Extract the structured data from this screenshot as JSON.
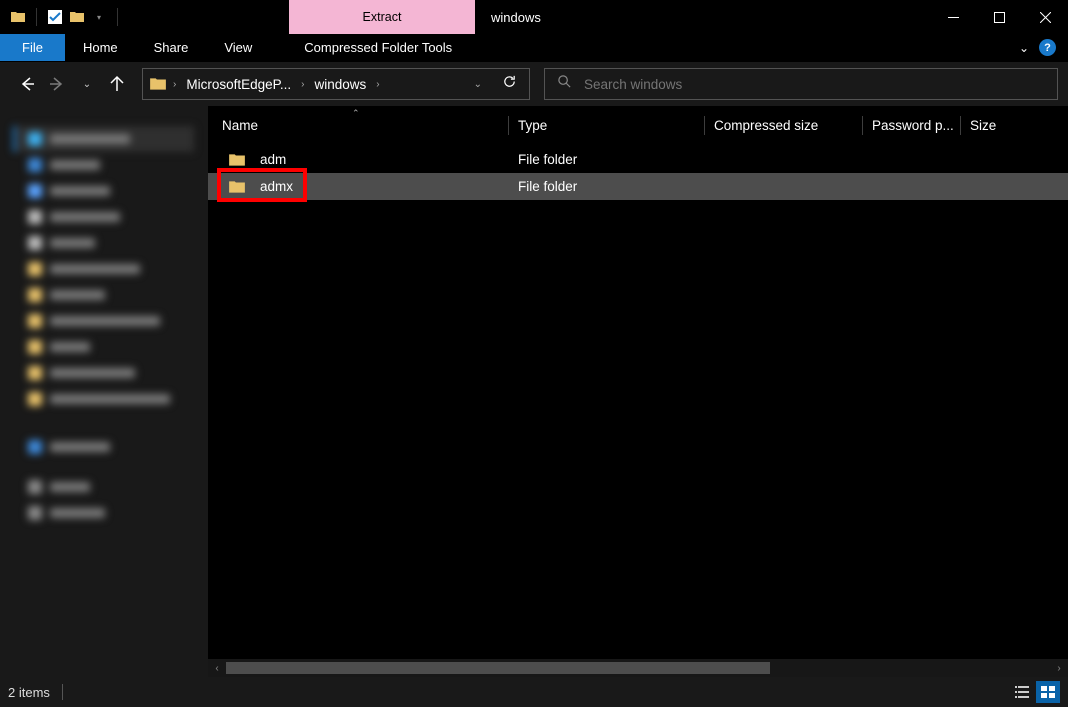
{
  "window": {
    "title": "windows",
    "extract_tab": "Extract",
    "ribbon_context": "Compressed Folder Tools"
  },
  "ribbon": {
    "file": "File",
    "home": "Home",
    "share": "Share",
    "view": "View"
  },
  "breadcrumb": {
    "segment1": "MicrosoftEdgeP...",
    "segment2": "windows"
  },
  "search": {
    "placeholder": "Search windows"
  },
  "columns": {
    "name": "Name",
    "type": "Type",
    "compressed": "Compressed size",
    "password": "Password p...",
    "size": "Size"
  },
  "rows": [
    {
      "name": "adm",
      "type": "File folder",
      "selected": false,
      "highlighted": false
    },
    {
      "name": "admx",
      "type": "File folder",
      "selected": true,
      "highlighted": true
    }
  ],
  "status": {
    "count": "2 items"
  },
  "icons": {
    "folder_color": "#e8c26a"
  }
}
